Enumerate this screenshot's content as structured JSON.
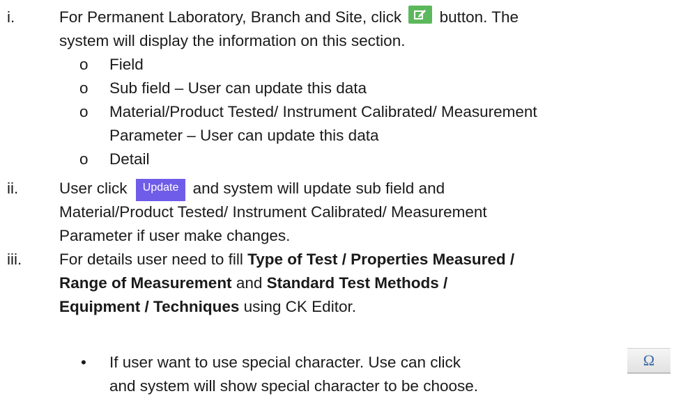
{
  "step_i": {
    "num": "i.",
    "text_pre": "For Permanent Laboratory, Branch and Site, click",
    "text_post": "button. The",
    "line2": "system will display the information on this section.",
    "icon": "edit-icon",
    "sub_bullet": "o",
    "items": [
      "Field",
      "Sub field – User can update this data",
      "Material/Product Tested/ Instrument Calibrated/ Measurement",
      "Parameter – User can update this data",
      "Detail"
    ]
  },
  "step_ii": {
    "num": "ii.",
    "text_pre": "User click",
    "button_label": "Update",
    "text_post": "and system will update sub field and",
    "line2": "Material/Product Tested/ Instrument Calibrated/ Measurement",
    "line3": "Parameter if user make changes."
  },
  "step_iii": {
    "num": "iii.",
    "l1_pre": "For details user need to fill",
    "l1_bold": "Type of Test / Properties Measured /",
    "l2_bold1": "Range of Measurement",
    "l2_and": "and",
    "l2_bold2": "Standard Test Methods /",
    "l3_bold": "Equipment / Techniques",
    "l3_post": "using CK Editor."
  },
  "note": {
    "bullet": "•",
    "line1": "If user want to use special character. Use can click",
    "line2": "and system will show special character to be choose.",
    "icon": "omega-icon",
    "icon_glyph": "Ω"
  },
  "colors": {
    "edit_button": "#5cb85c",
    "update_button": "#6f5ce8",
    "omega_glyph": "#3c6aa6"
  }
}
